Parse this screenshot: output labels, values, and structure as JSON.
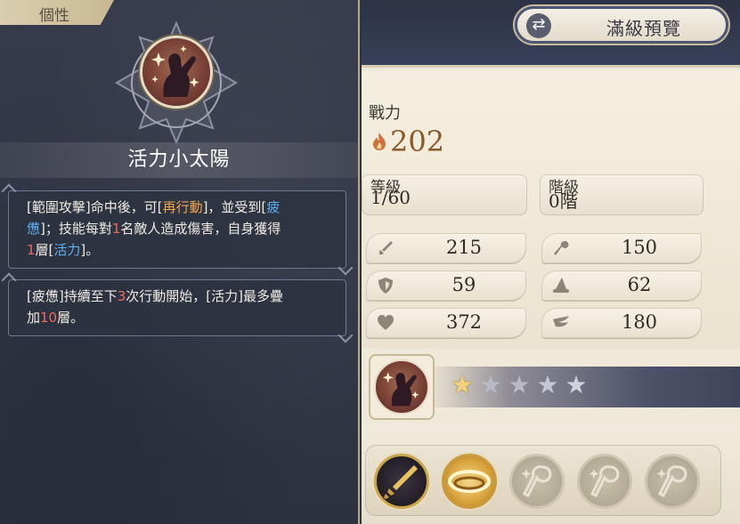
{
  "left_panel": {
    "tab_label": "個性",
    "skill_name": "活力小太陽",
    "desc1": {
      "line1": [
        {
          "t": "[範圍攻擊]命中後，可[",
          "c": ""
        },
        {
          "t": "再行動",
          "c": "kw-o"
        },
        {
          "t": "]，並受到[",
          "c": ""
        },
        {
          "t": "疲",
          "c": "kw-b"
        }
      ],
      "line2": [
        {
          "t": "憊",
          "c": "kw-b"
        },
        {
          "t": "]；技能每對",
          "c": ""
        },
        {
          "t": "1",
          "c": "kw-r"
        },
        {
          "t": "名敵人造成傷害，自身獲得",
          "c": ""
        }
      ],
      "line3": [
        {
          "t": "1",
          "c": "kw-r"
        },
        {
          "t": "層[",
          "c": ""
        },
        {
          "t": "活力",
          "c": "kw-b"
        },
        {
          "t": "]。",
          "c": ""
        }
      ]
    },
    "desc2": {
      "line1": [
        {
          "t": "[疲憊]持續至下",
          "c": ""
        },
        {
          "t": "3",
          "c": "kw-r"
        },
        {
          "t": "次行動開始，[活力]最多疊",
          "c": ""
        }
      ],
      "line2": [
        {
          "t": "加",
          "c": ""
        },
        {
          "t": "10",
          "c": "kw-r"
        },
        {
          "t": "層。",
          "c": ""
        }
      ]
    }
  },
  "right_panel": {
    "preview_button_label": "滿級預覽",
    "power_label": "戰力",
    "power_value": "202",
    "level_label": "等級",
    "level_value": "1/60",
    "rank_label": "階級",
    "rank_value": "0階",
    "stats": [
      {
        "icon": "sword-icon",
        "value": "215"
      },
      {
        "icon": "staff-icon",
        "value": "150"
      },
      {
        "icon": "shield-icon",
        "value": "59"
      },
      {
        "icon": "wizard-hat-icon",
        "value": "62"
      },
      {
        "icon": "heart-icon",
        "value": "372"
      },
      {
        "icon": "speed-wing-icon",
        "value": "180"
      }
    ],
    "stars": {
      "filled": 1,
      "total": 5
    },
    "skill_slots": [
      "sword-skill-icon",
      "golden-ring-skill-icon",
      "locked-staff-icon",
      "locked-staff-icon",
      "locked-staff-icon"
    ]
  },
  "colors": {
    "keyword_orange": "#f2a84a",
    "keyword_blue": "#5fb0ee",
    "keyword_red": "#f06a57",
    "power_text": "#8a5a2a"
  }
}
